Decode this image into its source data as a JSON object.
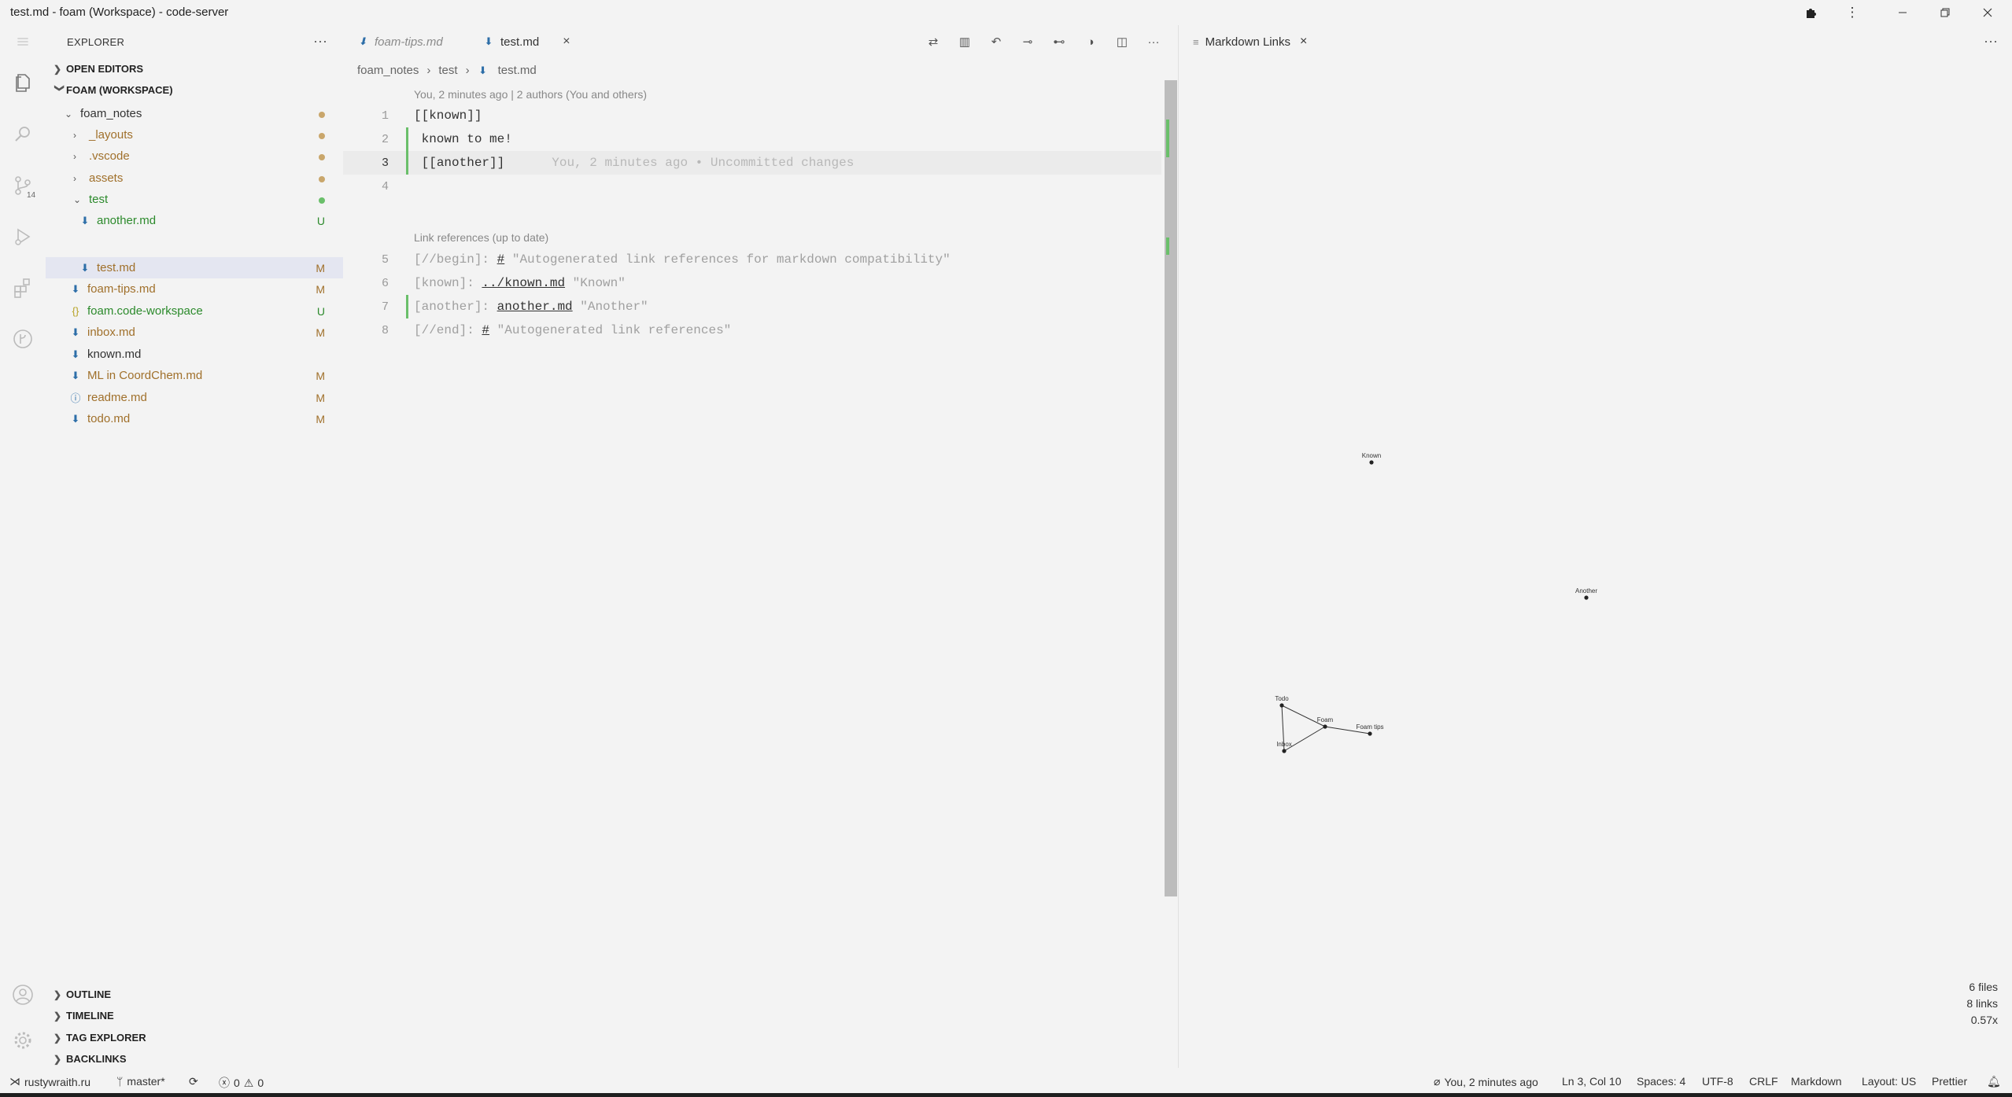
{
  "window": {
    "title": "test.md - foam (Workspace) - code-server"
  },
  "activity_bar": {
    "scm_badge": "14"
  },
  "sidebar": {
    "header": "EXPLORER",
    "more": "···",
    "open_editors": "OPEN EDITORS",
    "workspace": "FOAM (WORKSPACE)",
    "tree": [
      {
        "label": "foam_notes",
        "kind": "folder",
        "status": "dot",
        "color": "#a0702b"
      },
      {
        "label": "_layouts",
        "kind": "folder",
        "status": "dot",
        "color": "#a0702b"
      },
      {
        "label": ".vscode",
        "kind": "folder",
        "status": "dot",
        "color": "#a0702b"
      },
      {
        "label": "assets",
        "kind": "folder",
        "status": "dot",
        "color": "#a0702b"
      },
      {
        "label": "test",
        "kind": "folder",
        "status": "dot",
        "color": "#2c8a2c"
      },
      {
        "label": "another.md",
        "kind": "md",
        "status": "U",
        "color": "#2c8a2c"
      },
      {
        "label": "test.md",
        "kind": "md",
        "status": "M",
        "color": "#a0702b"
      },
      {
        "label": "foam-tips.md",
        "kind": "md",
        "status": "M",
        "color": "#a0702b"
      },
      {
        "label": "foam.code-workspace",
        "kind": "json",
        "status": "U",
        "color": "#2c8a2c"
      },
      {
        "label": "inbox.md",
        "kind": "md",
        "status": "M",
        "color": "#a0702b"
      },
      {
        "label": "known.md",
        "kind": "md",
        "status": "",
        "color": "#333333"
      },
      {
        "label": "ML in CoordChem.md",
        "kind": "md",
        "status": "M",
        "color": "#a0702b"
      },
      {
        "label": "readme.md",
        "kind": "info",
        "status": "M",
        "color": "#a0702b"
      },
      {
        "label": "todo.md",
        "kind": "md",
        "status": "M",
        "color": "#a0702b"
      }
    ],
    "bottom_sections": [
      "OUTLINE",
      "TIMELINE",
      "TAG EXPLORER",
      "BACKLINKS"
    ]
  },
  "editor": {
    "tabs": [
      {
        "label": "foam-tips.md"
      },
      {
        "label": "test.md",
        "close": "×"
      }
    ],
    "breadcrumb": [
      "foam_notes",
      "test",
      "test.md"
    ],
    "codelens_blame": "You, 2 minutes ago | 2 authors (You and others)",
    "codelens_links": "Link references (up to date)",
    "lines": {
      "l1": "[[known]]",
      "l2": " known to me!",
      "l3_open": " [[",
      "l3_word": "another",
      "l3_close": "]]",
      "l3_blame": "You, 2 minutes ago • Uncommitted changes",
      "l5_key": "[//begin]: ",
      "l5_hash": "#",
      "l5_rest": " \"Autogenerated link references for markdown compatibility\"",
      "l6_key": "[known]: ",
      "l6_link": "../known.md",
      "l6_rest": " \"Known\"",
      "l7_key": "[another]: ",
      "l7_link": "another.md",
      "l7_rest": " \"Another\"",
      "l8_key": "[//end]: ",
      "l8_hash": "#",
      "l8_rest": " \"Autogenerated link references\""
    },
    "line_numbers": [
      "1",
      "2",
      "3",
      "4",
      "5",
      "6",
      "7",
      "8"
    ]
  },
  "graph": {
    "tab_label": "Markdown Links",
    "tab_close": "×",
    "more": "···",
    "nodes": [
      "Known",
      "Another",
      "Todo",
      "Foam",
      "Foam tips",
      "Inbox"
    ],
    "stats": [
      "6 files",
      "8 links",
      "0.57x"
    ]
  },
  "statusbar": {
    "remote": "rustywraith.ru",
    "branch": "master*",
    "errors": "0",
    "warnings": "0",
    "blame": "You, 2 minutes ago",
    "position": "Ln 3, Col 10",
    "spaces": "Spaces: 4",
    "encoding": "UTF-8",
    "eol": "CRLF",
    "language": "Markdown",
    "layout": "Layout: US",
    "formatter": "Prettier"
  }
}
